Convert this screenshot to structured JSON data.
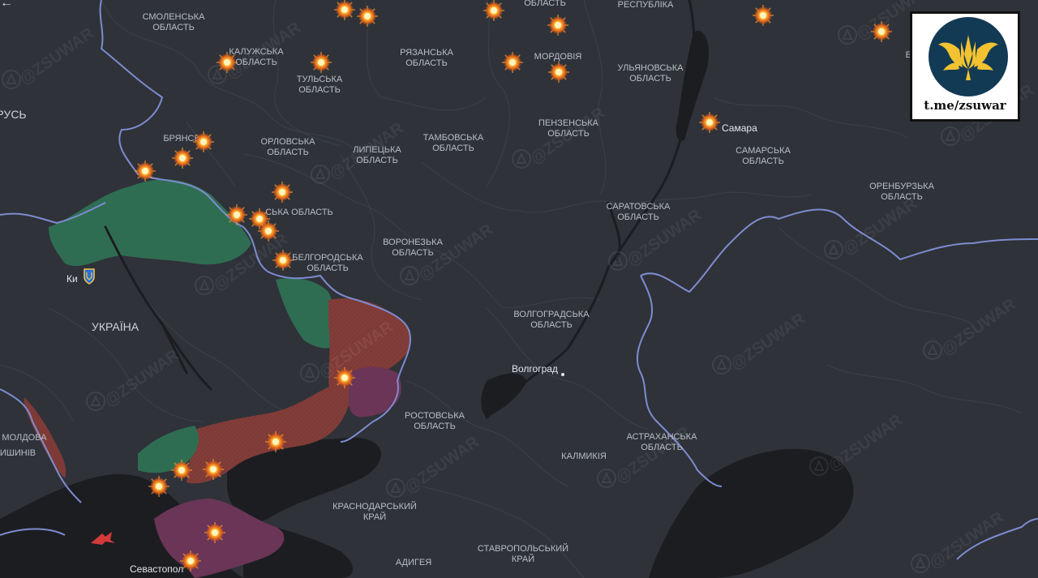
{
  "map": {
    "colors": {
      "land": "#2f3239",
      "sea": "#1c1d21",
      "border": "#7d8ccf",
      "occupied_red": "#7e3a36",
      "occupied_purple": "#6a3556",
      "liberated_green": "#2f6d52",
      "explosion": "#f6b73c"
    },
    "regions": [
      {
        "id": "smolensk",
        "text": "СМОЛЕНСЬКА\nОБЛАСТЬ"
      },
      {
        "id": "kaluga",
        "text": "КАЛУЖСЬКА\nОБЛАСТЬ"
      },
      {
        "id": "tula",
        "text": "ТУЛЬСЬКА\nОБЛАСТЬ"
      },
      {
        "id": "ryazan",
        "text": "РЯЗАНСЬКА\nОБЛАСТЬ"
      },
      {
        "id": "mordovia",
        "text": "МОРДОВІЯ"
      },
      {
        "id": "ulyanovsk",
        "text": "УЛЬЯНОВСЬКА\nОБЛАСТЬ"
      },
      {
        "id": "respublika",
        "text": "РЕСПУБЛІКА"
      },
      {
        "id": "oblast_top",
        "text": "ОБЛАСТЬ"
      },
      {
        "id": "bryansk",
        "text": "БРЯНСЬ"
      },
      {
        "id": "orel",
        "text": "ОРЛОВСЬКА\nОБЛАСТЬ"
      },
      {
        "id": "lipetsk",
        "text": "ЛИПЕЦЬКА\nОБЛАСТЬ"
      },
      {
        "id": "tambov",
        "text": "ТАМБОВСЬКА\nОБЛАСТЬ"
      },
      {
        "id": "penza",
        "text": "ПЕНЗЕНСЬКА\nОБЛАСТЬ"
      },
      {
        "id": "samara_obl",
        "text": "САМАРСЬКА\nОБЛАСТЬ"
      },
      {
        "id": "orenburg",
        "text": "ОРЕНБУРЗЬКА\nОБЛАСТЬ"
      },
      {
        "id": "kursk",
        "text": "СЬКА ОБЛАСТЬ"
      },
      {
        "id": "saratov",
        "text": "САРАТОВСЬКА\nОБЛАСТЬ"
      },
      {
        "id": "belgorod",
        "text": "БЕЛГОРОДСЬКА\nОБЛАСТЬ"
      },
      {
        "id": "voronezh",
        "text": "ВОРОНЕЗЬКА\nОБЛАСТЬ"
      },
      {
        "id": "volgograd_obl",
        "text": "ВОЛГОГРАДСЬКА\nОБЛАСТЬ"
      },
      {
        "id": "rostov",
        "text": "РОСТОВСЬКА\nОБЛАСТЬ"
      },
      {
        "id": "astrakhan",
        "text": "АСТРАХАНСЬКА\nОБЛАСТЬ"
      },
      {
        "id": "kalmykia",
        "text": "КАЛМИКІЯ"
      },
      {
        "id": "krasnodar",
        "text": "КРАСНОДАРСЬКИЙ\nКРАЙ"
      },
      {
        "id": "stavropol",
        "text": "СТАВРОПОЛЬСЬКИЙ\nКРАЙ"
      },
      {
        "id": "adygea",
        "text": "АДИГЕЯ"
      },
      {
        "id": "moldova",
        "text": "МОЛДОВА"
      },
      {
        "id": "bashk",
        "text": "БАШК"
      }
    ],
    "countries": {
      "ukraine": "УКРАЇНА",
      "belarus": "РУСЬ"
    },
    "cities": {
      "kyiv": "Ки",
      "kishinev": "ИШИНІВ",
      "volgograd": "Волгоград",
      "samara": "Самара",
      "sevastopol": "Севастопол"
    },
    "watermark": "@ZSUWAR",
    "explosion_count": 30
  },
  "logo": {
    "text": "t.me/zsuwar",
    "icon": "trident-wings-icon"
  },
  "ui": {
    "back_icon": "←"
  }
}
